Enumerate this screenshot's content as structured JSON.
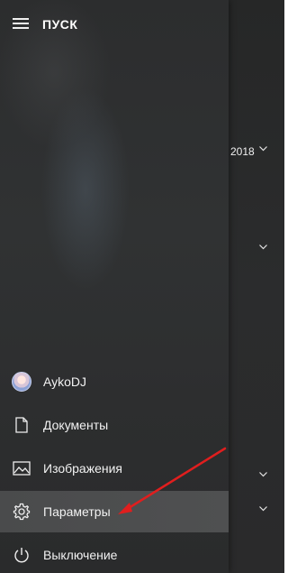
{
  "start_menu": {
    "title": "ПУСК",
    "items": [
      {
        "label": "AykoDJ",
        "icon": "user-avatar"
      },
      {
        "label": "Документы",
        "icon": "document-icon"
      },
      {
        "label": "Изображения",
        "icon": "image-icon"
      },
      {
        "label": "Параметры",
        "icon": "gear-icon"
      },
      {
        "label": "Выключение",
        "icon": "power-icon"
      }
    ],
    "selected_item": "Параметры"
  },
  "tiles_area": {
    "year_label": "2018"
  },
  "annotation": {
    "arrow_color": "#e01e1e"
  }
}
